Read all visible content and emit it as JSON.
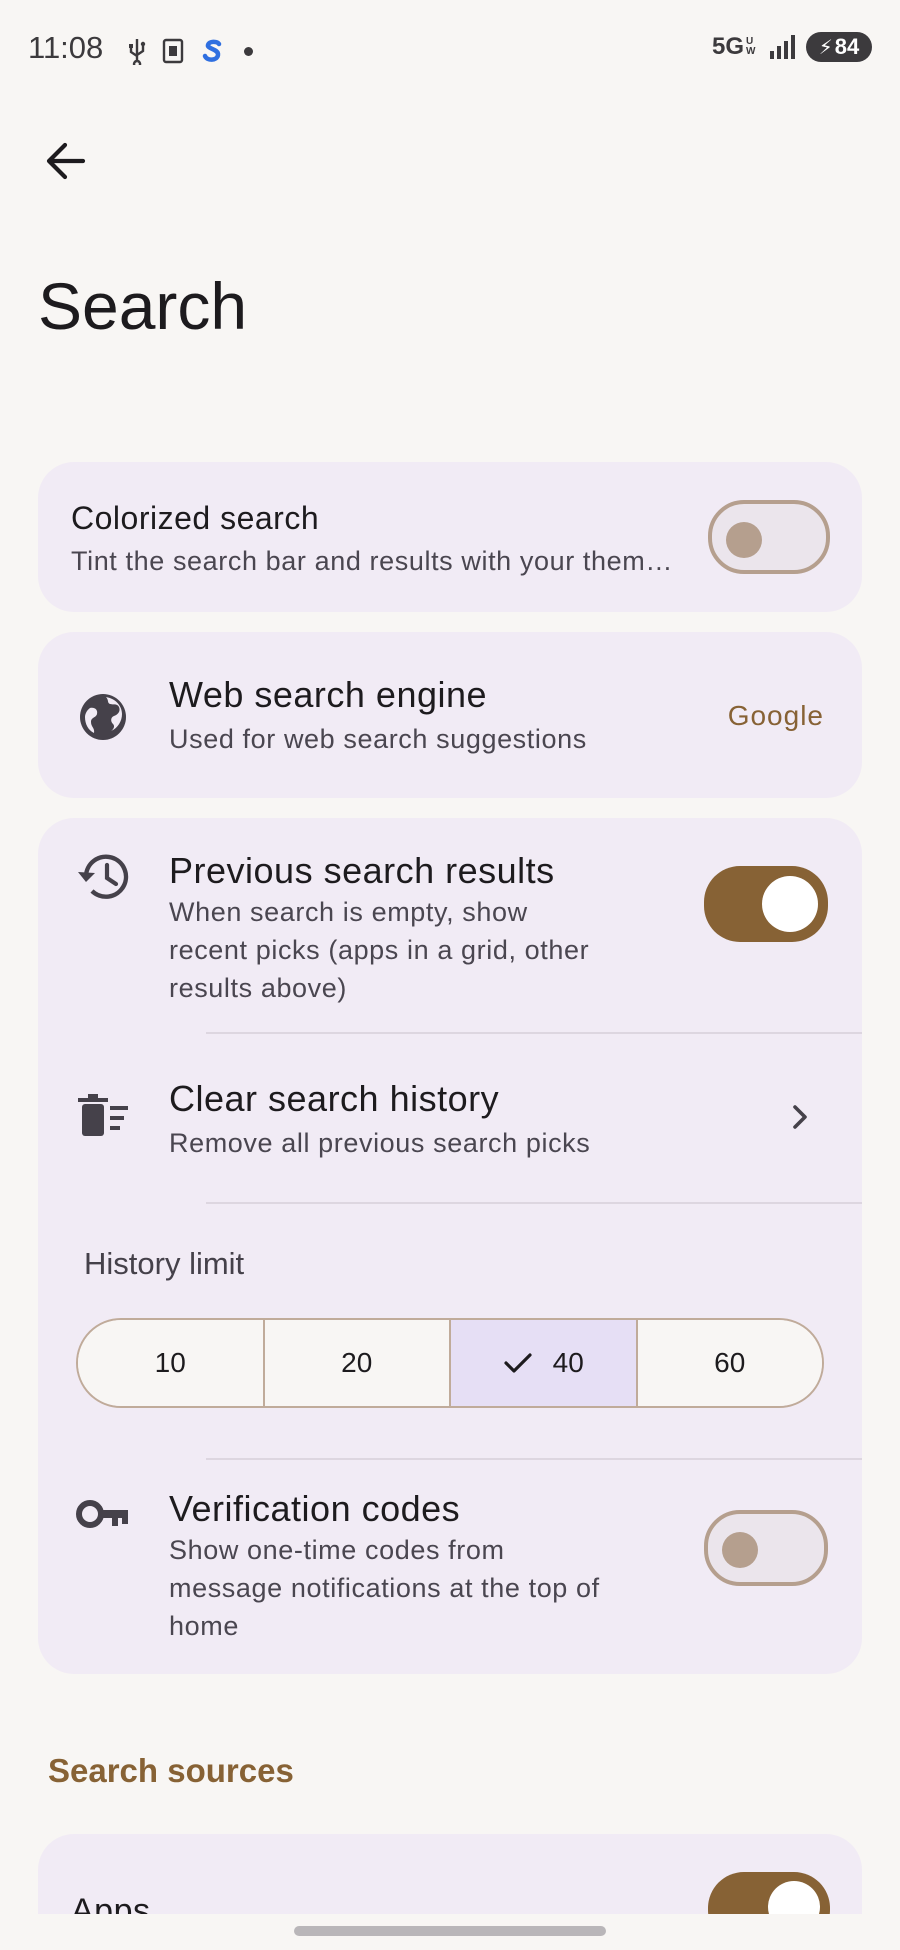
{
  "status_bar": {
    "time": "11:08",
    "network": "5G",
    "network_sub": "UW",
    "battery": "84",
    "icons": [
      "usb-icon",
      "sim-card-icon",
      "s-app-icon",
      "dot-icon",
      "signal-icon",
      "battery-charging-icon"
    ]
  },
  "header": {
    "back_icon": "arrow-left-icon",
    "title": "Search"
  },
  "colorized_search": {
    "title": "Colorized search",
    "subtitle": "Tint the search bar and results with your them…",
    "enabled": false
  },
  "web_search": {
    "icon": "globe-icon",
    "title": "Web search engine",
    "subtitle": "Used for web search suggestions",
    "value": "Google"
  },
  "previous_results": {
    "icon": "history-icon",
    "title": "Previous search results",
    "subtitle_lines": [
      "When search is empty, show",
      "recent picks (apps in a grid, other",
      "results above)"
    ],
    "enabled": true
  },
  "clear_history": {
    "icon": "delete-sweep-icon",
    "title": "Clear search history",
    "subtitle": "Remove all previous search picks"
  },
  "history_limit": {
    "label": "History limit",
    "options": [
      "10",
      "20",
      "40",
      "60"
    ],
    "selected": "40"
  },
  "verification": {
    "icon": "key-icon",
    "title": "Verification codes",
    "subtitle_lines": [
      "Show one-time codes from",
      "message notifications at the top of",
      "home"
    ],
    "enabled": false
  },
  "sources": {
    "header": "Search sources",
    "apps_title": "Apps",
    "apps_enabled": true
  },
  "colors": {
    "accent": "#876235",
    "card_bg": "#f1ebf5",
    "page_bg": "#f8f6f4",
    "segment_selected": "#e6dff5"
  }
}
